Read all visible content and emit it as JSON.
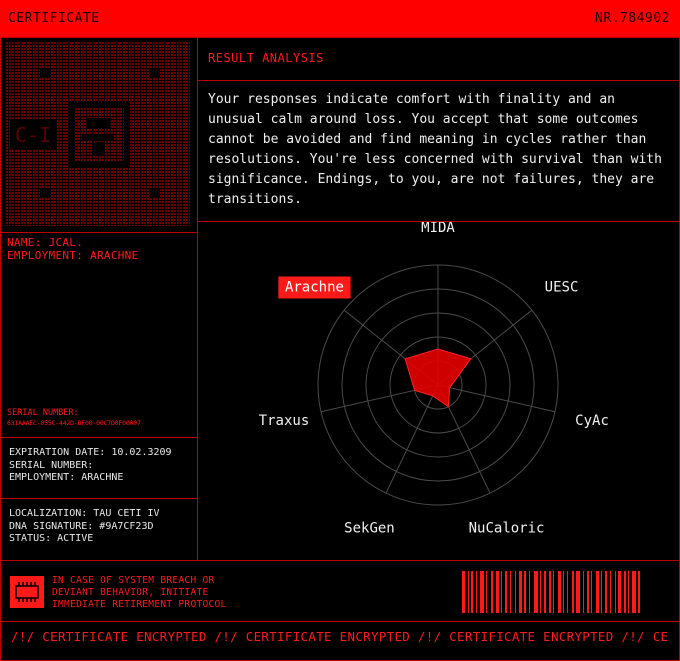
{
  "header": {
    "title": "CERTIFICATE",
    "number": "NR.784902"
  },
  "identity": {
    "name_line": "NAME: JCAL.",
    "employment_line": "EMPLOYMENT: ARACHNE",
    "serial_label": "SERIAL NUMBER:",
    "serial_value": "631AAAEC-055C-442D-BF00-00C7D0F00007"
  },
  "details": {
    "expiration": "EXPIRATION DATE: 10.02.3209",
    "serial": "SERIAL NUMBER:",
    "employment": "EMPLOYMENT: ARACHNE"
  },
  "location": {
    "localization": "LOCALIZATION: TAU CETI IV",
    "dna": "DNA SIGNATURE: #9A7CF23D",
    "status": "STATUS: ACTIVE"
  },
  "analysis": {
    "title": "RESULT ANALYSIS",
    "text": "Your responses indicate comfort with finality and an unusual calm around loss. You accept that some outcomes cannot be avoided and find meaning in cycles rather than resolutions. You're less concerned with survival than with significance. Endings, to you, are not failures, they are transitions."
  },
  "chart_data": {
    "type": "radar",
    "axes": [
      "MIDA",
      "UESC",
      "CyAc",
      "NuCaloric",
      "SekGen",
      "Traxus",
      "Arachne"
    ],
    "values": [
      0.3,
      0.35,
      0.1,
      0.2,
      0.1,
      0.2,
      0.35
    ],
    "highlighted": "Arachne",
    "rings": 5,
    "accent": "#ff1a1a"
  },
  "warning": {
    "line1": "IN CASE OF SYSTEM BREACH OR",
    "line2": "DEVIANT BEHAVIOR, INITIATE",
    "line3": "IMMEDIATE RETIREMENT PROTOCOL",
    "icon": "warning-chip-icon"
  },
  "footer": {
    "banner": "/!/ CERTIFICATE ENCRYPTED /!/ CERTIFICATE ENCRYPTED /!/ CERTIFICATE ENCRYPTED /!/ CE"
  }
}
